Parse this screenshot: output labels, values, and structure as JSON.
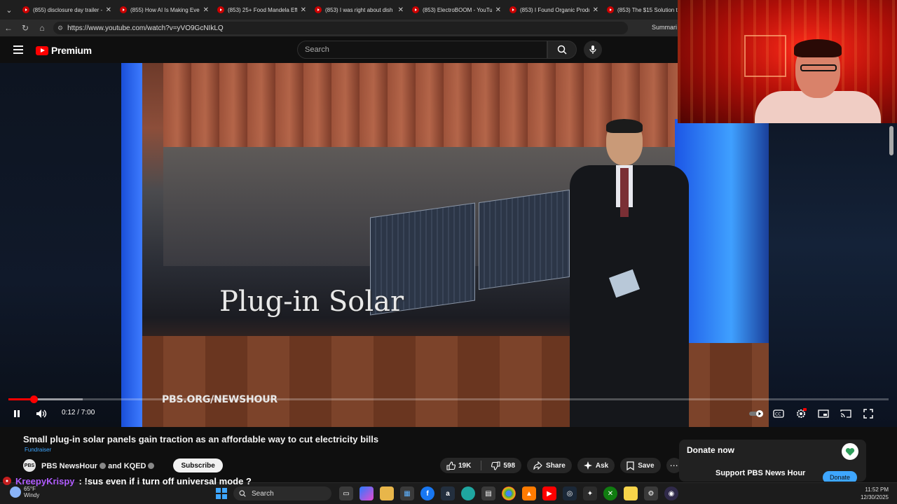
{
  "browser": {
    "tabs": [
      {
        "title": "(855) disclosure day trailer -"
      },
      {
        "title": "(855) How AI Is Making Ever"
      },
      {
        "title": "(853) 25+ Food Mandela Eff"
      },
      {
        "title": "(853) I was right about dish"
      },
      {
        "title": "(853) ElectroBOOM - YouTu"
      },
      {
        "title": "(853) I Found Organic Produ"
      },
      {
        "title": "(853) The $15 Solution to"
      }
    ],
    "url": "https://www.youtube.com/watch?v=yVO9GcNIkLQ",
    "extension_label": "Summari"
  },
  "youtube": {
    "logo_text": "Premium",
    "search_placeholder": "Search"
  },
  "player": {
    "overlay_text": "Plug-in Solar",
    "watermark": "PBS.ORG/NEWSHOUR",
    "time_current": "0:12",
    "time_total": "7:00",
    "time_display": "0:12 / 7:00",
    "progress_fraction": 0.0286,
    "buffered_fraction": 0.084,
    "state": "playing"
  },
  "video_info": {
    "title": "Small plug-in solar panels gain traction as an affordable way to cut electricity bills",
    "fundraiser_label": "Fundraiser",
    "channel_name": "PBS NewsHour",
    "collab_text": "and KQED",
    "subscribe_label": "Subscribe",
    "like_count": "19K",
    "dislike_count": "598",
    "share_label": "Share",
    "ask_label": "Ask",
    "save_label": "Save"
  },
  "donate_card": {
    "title": "Donate now",
    "subtitle": "Support PBS News Hour",
    "button_label": "Donate"
  },
  "chat": {
    "username": "KreepyKrispy",
    "message": ": !sus even if i turn off universal mode ?"
  },
  "taskbar": {
    "temperature": "65°F",
    "weather": "Windy",
    "search_label": "Search",
    "time": "11:52 PM",
    "date": "12/30/2025"
  },
  "colors": {
    "youtube_red": "#ff0000",
    "chat_username": "#b05cff",
    "link_blue": "#3ea6ff"
  }
}
